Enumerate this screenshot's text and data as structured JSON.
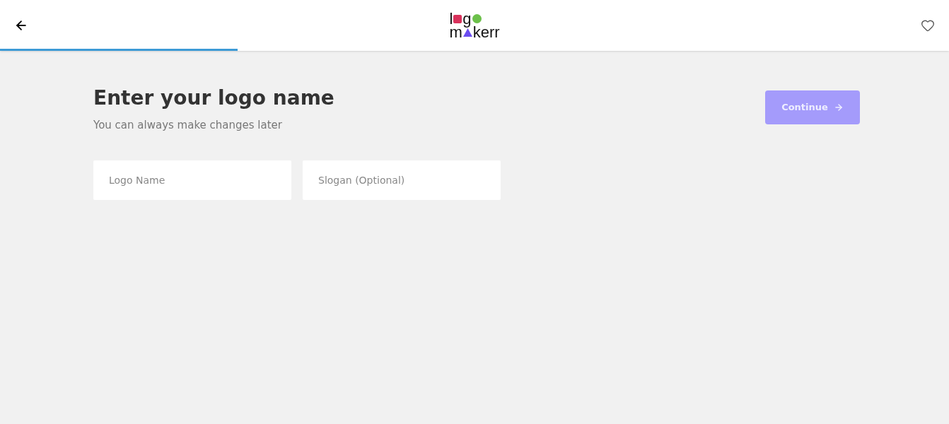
{
  "header": {
    "logo": {
      "line_1": [
        "l",
        "g"
      ],
      "line_2": [
        "m",
        "kerr"
      ]
    },
    "favorite": false
  },
  "progress": {
    "level": 0.25
  },
  "heading": "Enter your logo name",
  "subheading": "You can always make changes later",
  "continue_button": {
    "label": "Continue",
    "disabled": true
  },
  "fields": [
    {
      "placeholder": "Logo Name"
    },
    {
      "placeholder": "Slogan (Optional)"
    }
  ]
}
